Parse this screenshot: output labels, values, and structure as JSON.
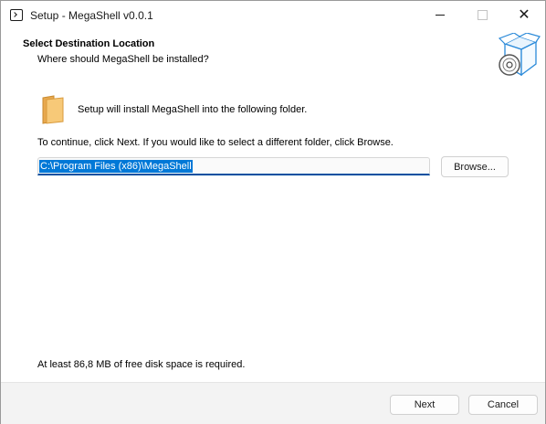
{
  "window": {
    "title": "Setup - MegaShell v0.0.1"
  },
  "header": {
    "title": "Select Destination Location",
    "subtitle": "Where should MegaShell be installed?",
    "graphic_icon": "box-disc-icon"
  },
  "content": {
    "install_text": "Setup will install MegaShell into the following folder.",
    "continue_text": "To continue, click Next. If you would like to select a different folder, click Browse.",
    "path_value": "C:\\Program Files (x86)\\MegaShell",
    "browse_label": "Browse...",
    "disk_space_text": "At least 86,8 MB of free disk space is required.",
    "folder_icon": "folder-icon"
  },
  "footer": {
    "next_label": "Next",
    "cancel_label": "Cancel"
  },
  "colors": {
    "accent": "#0078d7",
    "input_underline": "#0050a0",
    "footer_bg": "#f3f3f3",
    "folder": "#f5c06a"
  }
}
